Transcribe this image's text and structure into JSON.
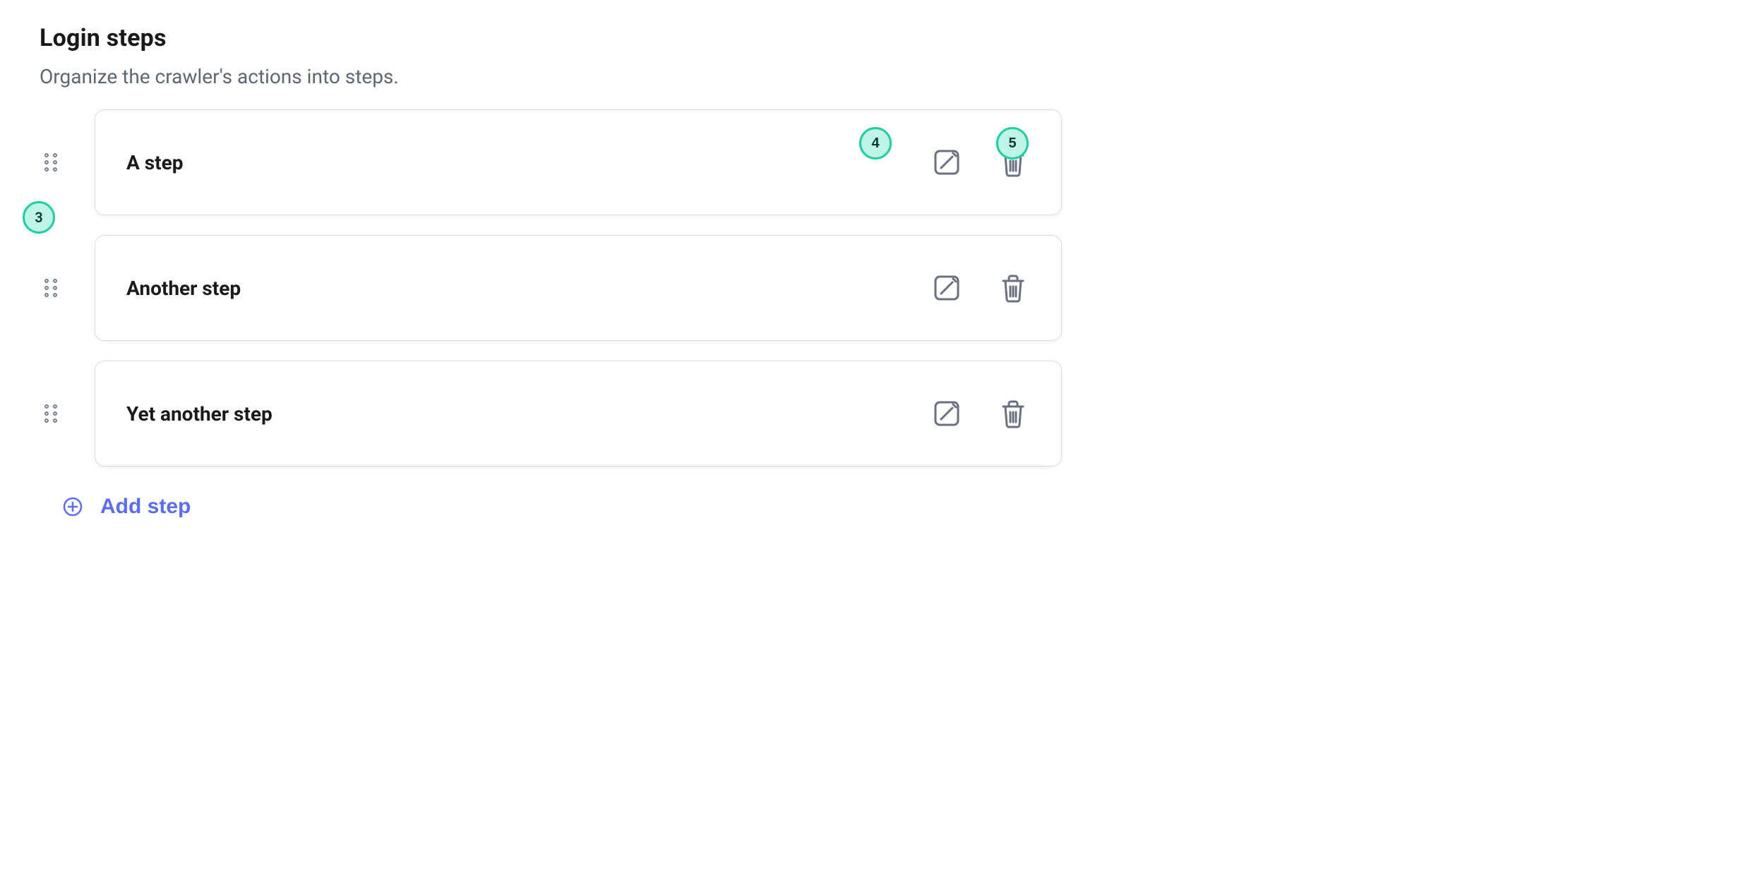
{
  "header": {
    "title": "Login steps",
    "subtitle": "Organize the crawler's actions into steps."
  },
  "steps": [
    {
      "label": "A step"
    },
    {
      "label": "Another step"
    },
    {
      "label": "Yet another step"
    }
  ],
  "addButton": {
    "label": "Add step"
  },
  "markers": {
    "drag": "3",
    "edit": "4",
    "delete": "5"
  }
}
